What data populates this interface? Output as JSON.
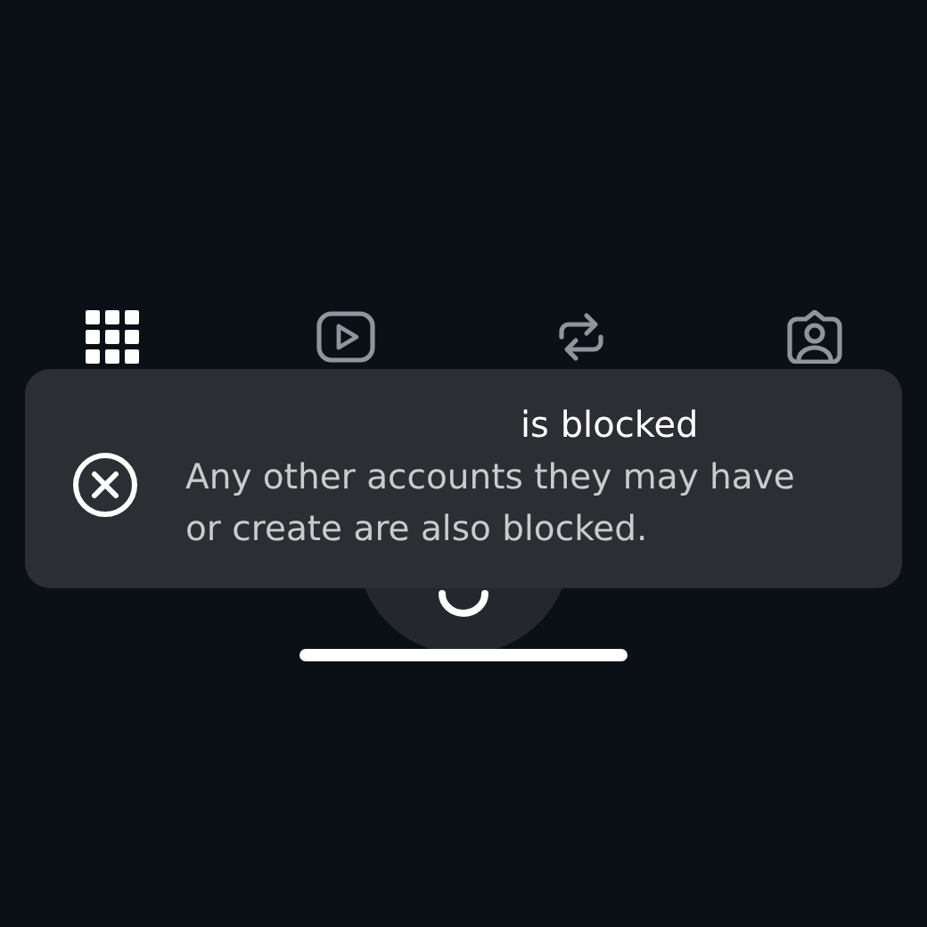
{
  "tabs": [
    {
      "kind": "grid",
      "selected": true
    },
    {
      "kind": "reels",
      "selected": false
    },
    {
      "kind": "reposts",
      "selected": false
    },
    {
      "kind": "tagged",
      "selected": false
    }
  ],
  "toast": {
    "title": "is blocked",
    "message": "Any other accounts they may have or create are also blocked."
  }
}
